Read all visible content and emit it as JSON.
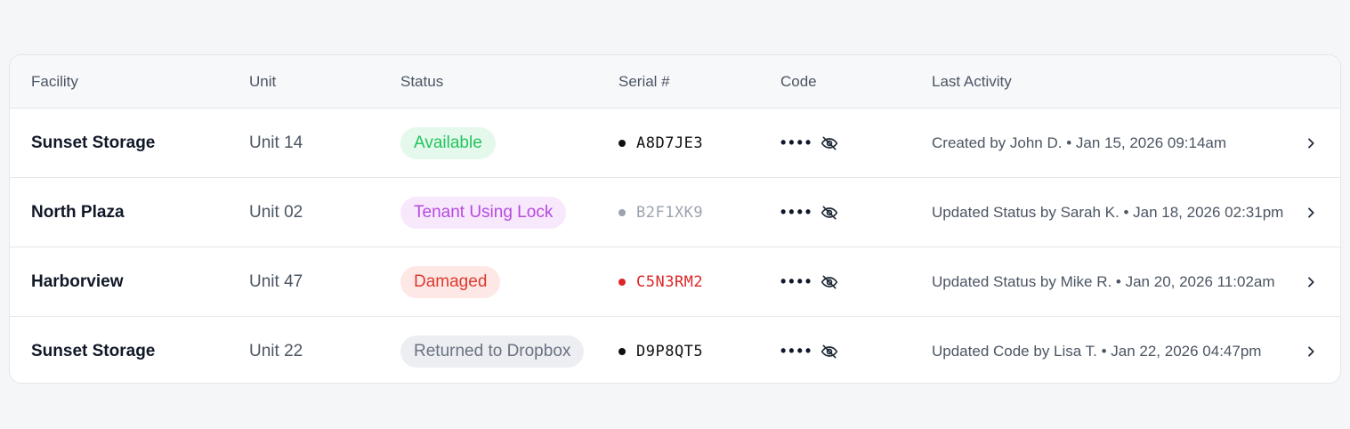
{
  "table": {
    "headers": {
      "facility": "Facility",
      "unit": "Unit",
      "status": "Status",
      "serial": "Serial #",
      "code": "Code",
      "last_activity": "Last Activity"
    },
    "rows": [
      {
        "facility": "Sunset Storage",
        "unit": "Unit 14",
        "status": "Available",
        "status_bg": "#e5f8ec",
        "status_color": "#22c55e",
        "serial": "A8D7JE3",
        "serial_color": "#111111",
        "dot_color": "#111111",
        "code_masked": "••••",
        "code_icon": "eye-off-icon",
        "last_activity": "Created by John D. • Jan 15, 2026 09:14am"
      },
      {
        "facility": "North Plaza",
        "unit": "Unit 02",
        "status": "Tenant Using Lock",
        "status_bg": "#f8e8fc",
        "status_color": "#b44ae0",
        "serial": "B2F1XK9",
        "serial_color": "#9ca3af",
        "dot_color": "#9ca3af",
        "code_masked": "••••",
        "code_icon": "eye-off-icon",
        "last_activity": "Updated Status by Sarah K. • Jan 18, 2026 02:31pm"
      },
      {
        "facility": "Harborview",
        "unit": "Unit 47",
        "status": "Damaged",
        "status_bg": "#fde8e6",
        "status_color": "#dc3a2e",
        "serial": "C5N3RM2",
        "serial_color": "#dc2626",
        "dot_color": "#dc2626",
        "code_masked": "••••",
        "code_icon": "eye-off-icon",
        "last_activity": "Updated Status by Mike R. • Jan 20, 2026 11:02am"
      },
      {
        "facility": "Sunset Storage",
        "unit": "Unit 22",
        "status": "Returned to Dropbox",
        "status_bg": "#eceef2",
        "status_color": "#6b7280",
        "serial": "D9P8QT5",
        "serial_color": "#111111",
        "dot_color": "#111111",
        "code_masked": "••••",
        "code_icon": "eye-off-icon",
        "last_activity": "Updated Code by Lisa T. • Jan 22, 2026 04:47pm"
      }
    ],
    "row_action_icon": "chevron-right-icon"
  }
}
